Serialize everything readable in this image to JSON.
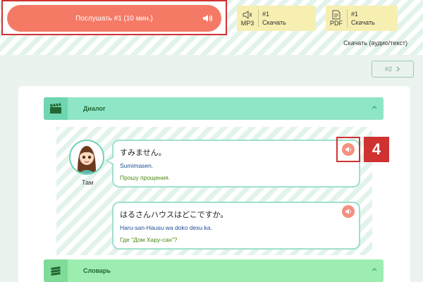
{
  "player": {
    "listen_label": "Послушать #1 (10 мин.)"
  },
  "downloads": {
    "mp3": {
      "format": "MP3",
      "number": "#1",
      "label": "Скачать"
    },
    "pdf": {
      "format": "PDF",
      "number": "#1",
      "label": "Скачать"
    },
    "all_label": "Скачать (аудио/текст)"
  },
  "nav": {
    "next_label": "#2"
  },
  "sections": {
    "dialog_title": "Диалог",
    "vocab_title": "Словарь"
  },
  "dialog": {
    "speaker_name": "Там",
    "lines": [
      {
        "japanese": "すみません。",
        "romaji": "Sumimasen.",
        "translation": "Прошу прощения."
      },
      {
        "japanese": "はるさんハウスはどこですか。",
        "romaji": "Haru-san-Hausu wa doko desu ka.",
        "translation": "Где \"Дом Хару-сан\"?"
      }
    ]
  },
  "annotation": {
    "step_number": "4"
  },
  "colors": {
    "listen_button": "#f57a66",
    "download_box": "#f7efb1",
    "dialog_bar": "#8fe6c7",
    "vocab_bar": "#9dedb1",
    "highlight": "#d03232",
    "romaji_text": "#1d4f91",
    "translation_text": "#4b8a12"
  },
  "icons": {
    "listen": "speaker-icon",
    "mp3": "speaker-outline-icon",
    "pdf": "document-icon",
    "next": "chevron-right-icon",
    "dialog": "clapperboard-icon",
    "vocab": "books-icon",
    "collapse": "chevron-up-icon",
    "line_audio": "speaker-icon"
  }
}
